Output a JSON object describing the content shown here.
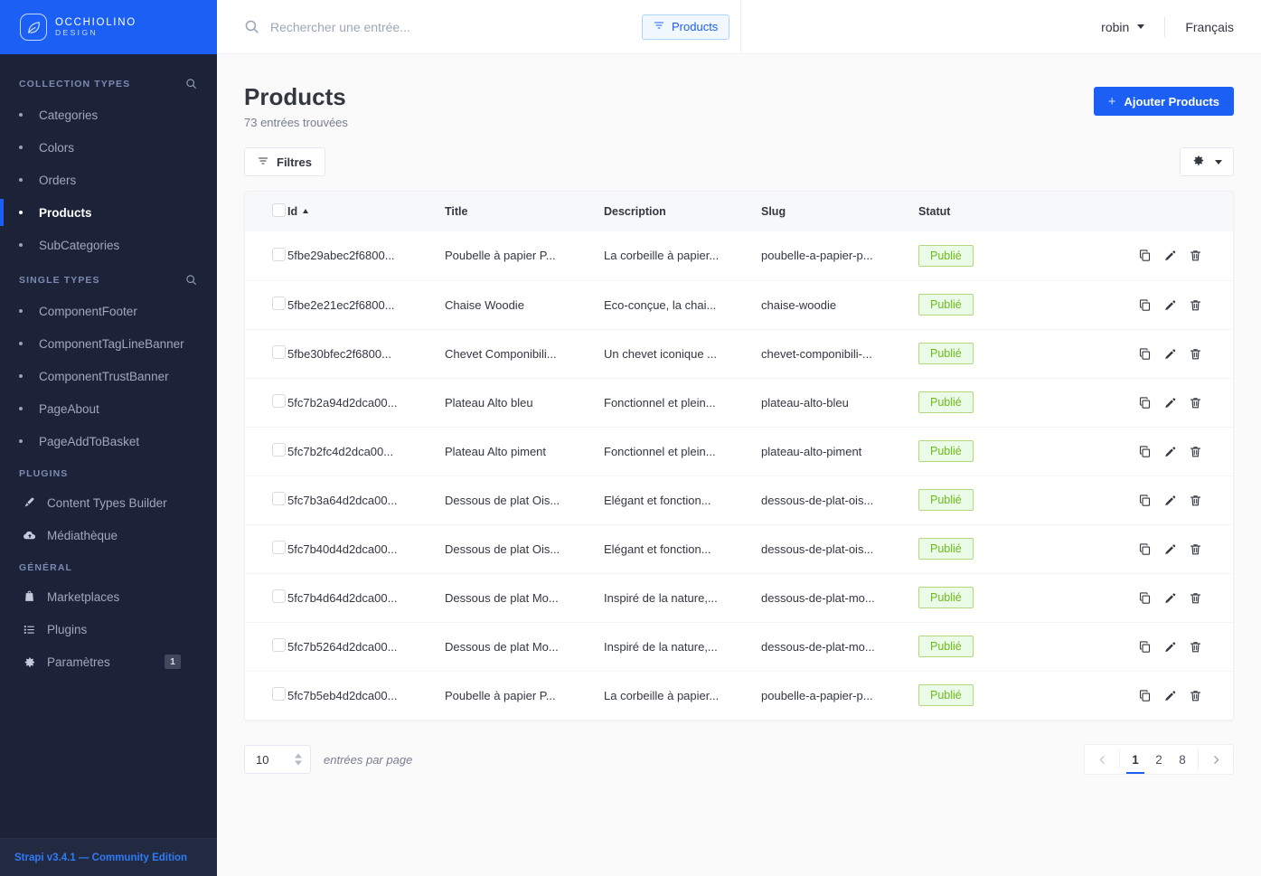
{
  "sidebar": {
    "logo": {
      "name": "OCCHIOLINO",
      "sub": "DESIGN",
      "icon": "leaf-icon"
    },
    "sections": [
      {
        "title": "COLLECTION TYPES",
        "has_search": true,
        "items": [
          {
            "label": "Categories",
            "active": false
          },
          {
            "label": "Colors",
            "active": false
          },
          {
            "label": "Orders",
            "active": false
          },
          {
            "label": "Products",
            "active": true
          },
          {
            "label": "SubCategories",
            "active": false
          }
        ]
      },
      {
        "title": "SINGLE TYPES",
        "has_search": true,
        "items": [
          {
            "label": "ComponentFooter",
            "active": false
          },
          {
            "label": "ComponentTagLineBanner",
            "active": false
          },
          {
            "label": "ComponentTrustBanner",
            "active": false
          },
          {
            "label": "PageAbout",
            "active": false
          },
          {
            "label": "PageAddToBasket",
            "active": false
          }
        ]
      },
      {
        "title": "PLUGINS",
        "has_search": false,
        "items": [
          {
            "label": "Content Types Builder",
            "icon": "brush-icon"
          },
          {
            "label": "Médiathèque",
            "icon": "cloud-icon"
          }
        ]
      },
      {
        "title": "GÉNÉRAL",
        "has_search": false,
        "items": [
          {
            "label": "Marketplaces",
            "icon": "shop-icon"
          },
          {
            "label": "Plugins",
            "icon": "list-icon"
          },
          {
            "label": "Paramètres",
            "icon": "gear-icon",
            "badge": "1"
          }
        ]
      }
    ],
    "footer": "Strapi v3.4.1 — Community Edition"
  },
  "topbar": {
    "search_placeholder": "Rechercher une entrée...",
    "search_value": "",
    "search_icon": "search-icon",
    "chip_label": "Products",
    "chip_icon": "filter-icon",
    "user": "robin",
    "language": "Français"
  },
  "page": {
    "title": "Products",
    "subtitle": "73 entrées trouvées",
    "add_button": "Ajouter Products",
    "add_icon": "plus-icon",
    "filters_button": "Filtres",
    "filters_icon": "filter-icon",
    "settings_icon": "gear-icon"
  },
  "table": {
    "columns": [
      "Id",
      "Title",
      "Description",
      "Slug",
      "Statut"
    ],
    "sorted_column": "Id",
    "sort_direction": "asc",
    "rows": [
      {
        "id": "5fbe29abec2f6800...",
        "title": "Poubelle à papier P...",
        "description": "La corbeille à papier...",
        "slug": "poubelle-a-papier-p...",
        "statut": "Publié"
      },
      {
        "id": "5fbe2e21ec2f6800...",
        "title": "Chaise Woodie",
        "description": "Eco-conçue, la chai...",
        "slug": "chaise-woodie",
        "statut": "Publié"
      },
      {
        "id": "5fbe30bfec2f6800...",
        "title": "Chevet Componibili...",
        "description": "Un chevet iconique ...",
        "slug": "chevet-componibili-...",
        "statut": "Publié"
      },
      {
        "id": "5fc7b2a94d2dca00...",
        "title": "Plateau Alto bleu",
        "description": "Fonctionnel et plein...",
        "slug": "plateau-alto-bleu",
        "statut": "Publié"
      },
      {
        "id": "5fc7b2fc4d2dca00...",
        "title": "Plateau Alto piment",
        "description": "Fonctionnel et plein...",
        "slug": "plateau-alto-piment",
        "statut": "Publié"
      },
      {
        "id": "5fc7b3a64d2dca00...",
        "title": "Dessous de plat Ois...",
        "description": "Elégant et fonction...",
        "slug": "dessous-de-plat-ois...",
        "statut": "Publié"
      },
      {
        "id": "5fc7b40d4d2dca00...",
        "title": "Dessous de plat Ois...",
        "description": "Elégant et fonction...",
        "slug": "dessous-de-plat-ois...",
        "statut": "Publié"
      },
      {
        "id": "5fc7b4d64d2dca00...",
        "title": "Dessous de plat Mo...",
        "description": "Inspiré de la nature,...",
        "slug": "dessous-de-plat-mo...",
        "statut": "Publié"
      },
      {
        "id": "5fc7b5264d2dca00...",
        "title": "Dessous de plat Mo...",
        "description": "Inspiré de la nature,...",
        "slug": "dessous-de-plat-mo...",
        "statut": "Publié"
      },
      {
        "id": "5fc7b5eb4d2dca00...",
        "title": "Poubelle à papier P...",
        "description": "La corbeille à papier...",
        "slug": "poubelle-a-papier-p...",
        "statut": "Publié"
      }
    ],
    "row_action_icons": [
      "duplicate-icon",
      "edit-icon",
      "delete-icon"
    ]
  },
  "pagination": {
    "per_page_value": "10",
    "per_page_label": "entrées par page",
    "pages": [
      "1",
      "2",
      "8"
    ],
    "current_page": "1",
    "prev_icon": "chevron-left-icon",
    "next_icon": "chevron-right-icon"
  },
  "colors": {
    "brand_blue": "#1c5ff4",
    "sidebar_bg": "#1c2238",
    "published_green": "#6dbb1a",
    "published_bg": "#eafbe7"
  }
}
